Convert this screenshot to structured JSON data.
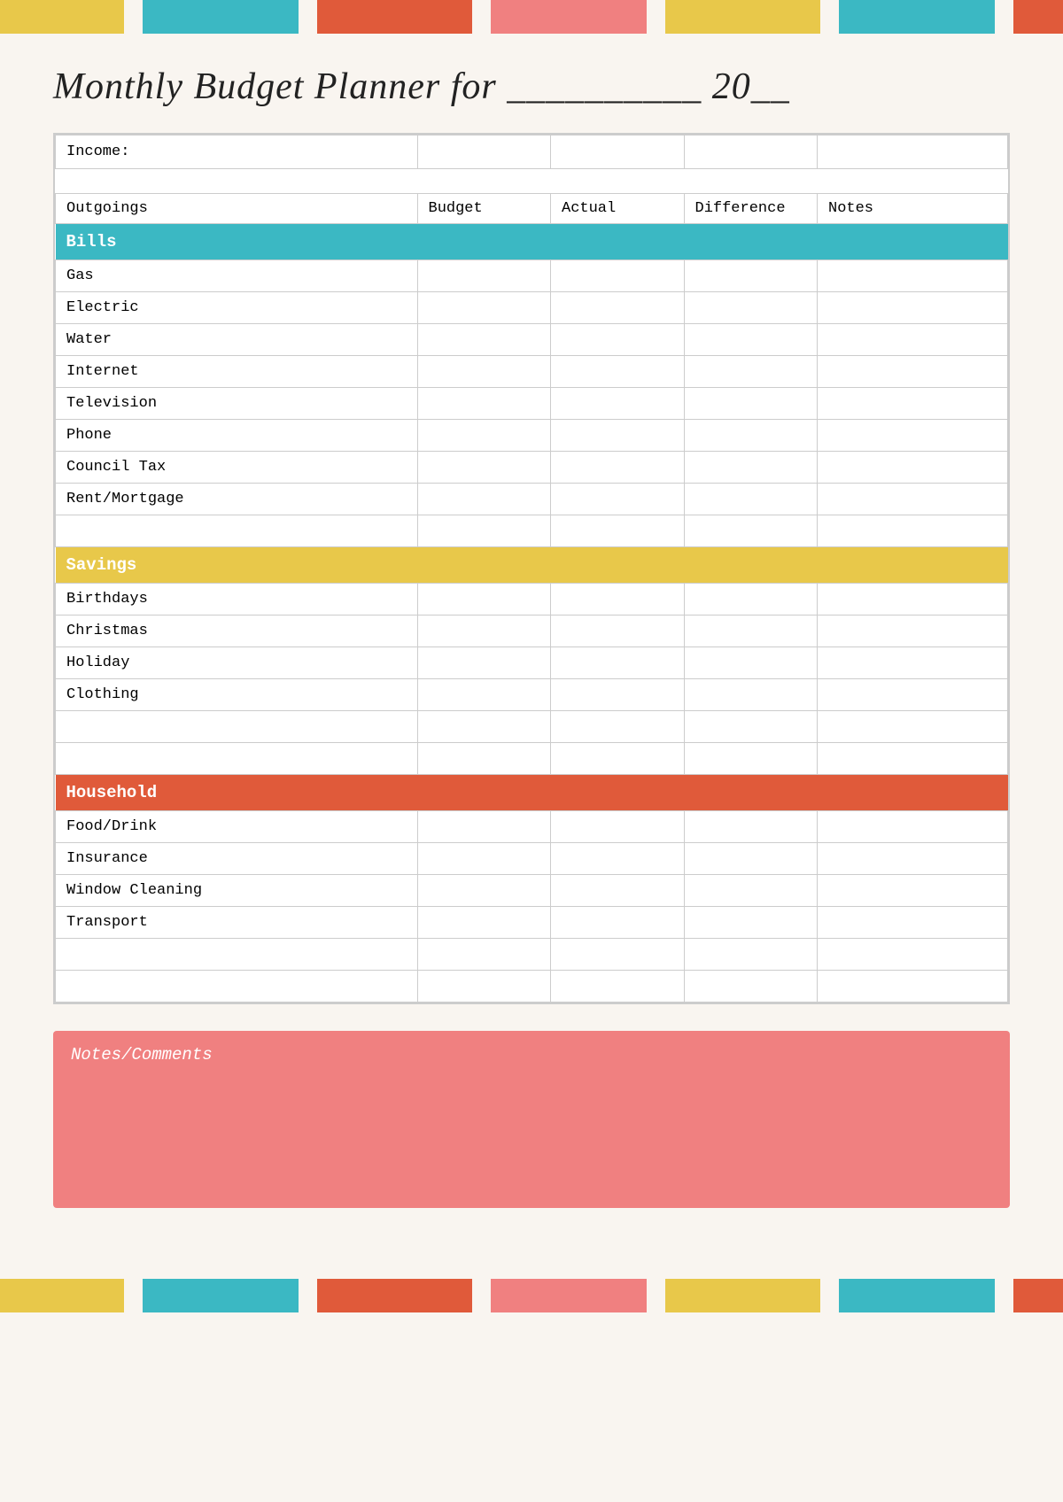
{
  "topBar": {
    "segments": [
      {
        "color": "#e8c84a",
        "flex": 2
      },
      {
        "color": "#f9f5f0",
        "flex": 0.3
      },
      {
        "color": "#3bb8c3",
        "flex": 2.5
      },
      {
        "color": "#f9f5f0",
        "flex": 0.3
      },
      {
        "color": "#e05a3a",
        "flex": 2.5
      },
      {
        "color": "#f9f5f0",
        "flex": 0.3
      },
      {
        "color": "#f08080",
        "flex": 2.5
      },
      {
        "color": "#f9f5f0",
        "flex": 0.3
      },
      {
        "color": "#e8c84a",
        "flex": 2.5
      },
      {
        "color": "#f9f5f0",
        "flex": 0.3
      },
      {
        "color": "#3bb8c3",
        "flex": 2.5
      },
      {
        "color": "#f9f5f0",
        "flex": 0.3
      },
      {
        "color": "#e05a3a",
        "flex": 0.8
      }
    ]
  },
  "title": {
    "line1": "Monthly Budget Planner for __________ 20__"
  },
  "table": {
    "incomeLabel": "Income:",
    "columns": {
      "outgoings": "Outgoings",
      "budget": "Budget",
      "actual": "Actual",
      "difference": "Difference",
      "notes": "Notes"
    },
    "sections": {
      "bills": {
        "label": "Bills",
        "items": [
          "Gas",
          "Electric",
          "Water",
          "Internet",
          "Television",
          "Phone",
          "Council Tax",
          "Rent/Mortgage"
        ]
      },
      "savings": {
        "label": "Savings",
        "items": [
          "Birthdays",
          "Christmas",
          "Holiday",
          "Clothing"
        ]
      },
      "household": {
        "label": "Household",
        "items": [
          "Food/Drink",
          "Insurance",
          "Window Cleaning",
          "Transport"
        ]
      }
    }
  },
  "notes": {
    "label": "Notes/Comments"
  }
}
